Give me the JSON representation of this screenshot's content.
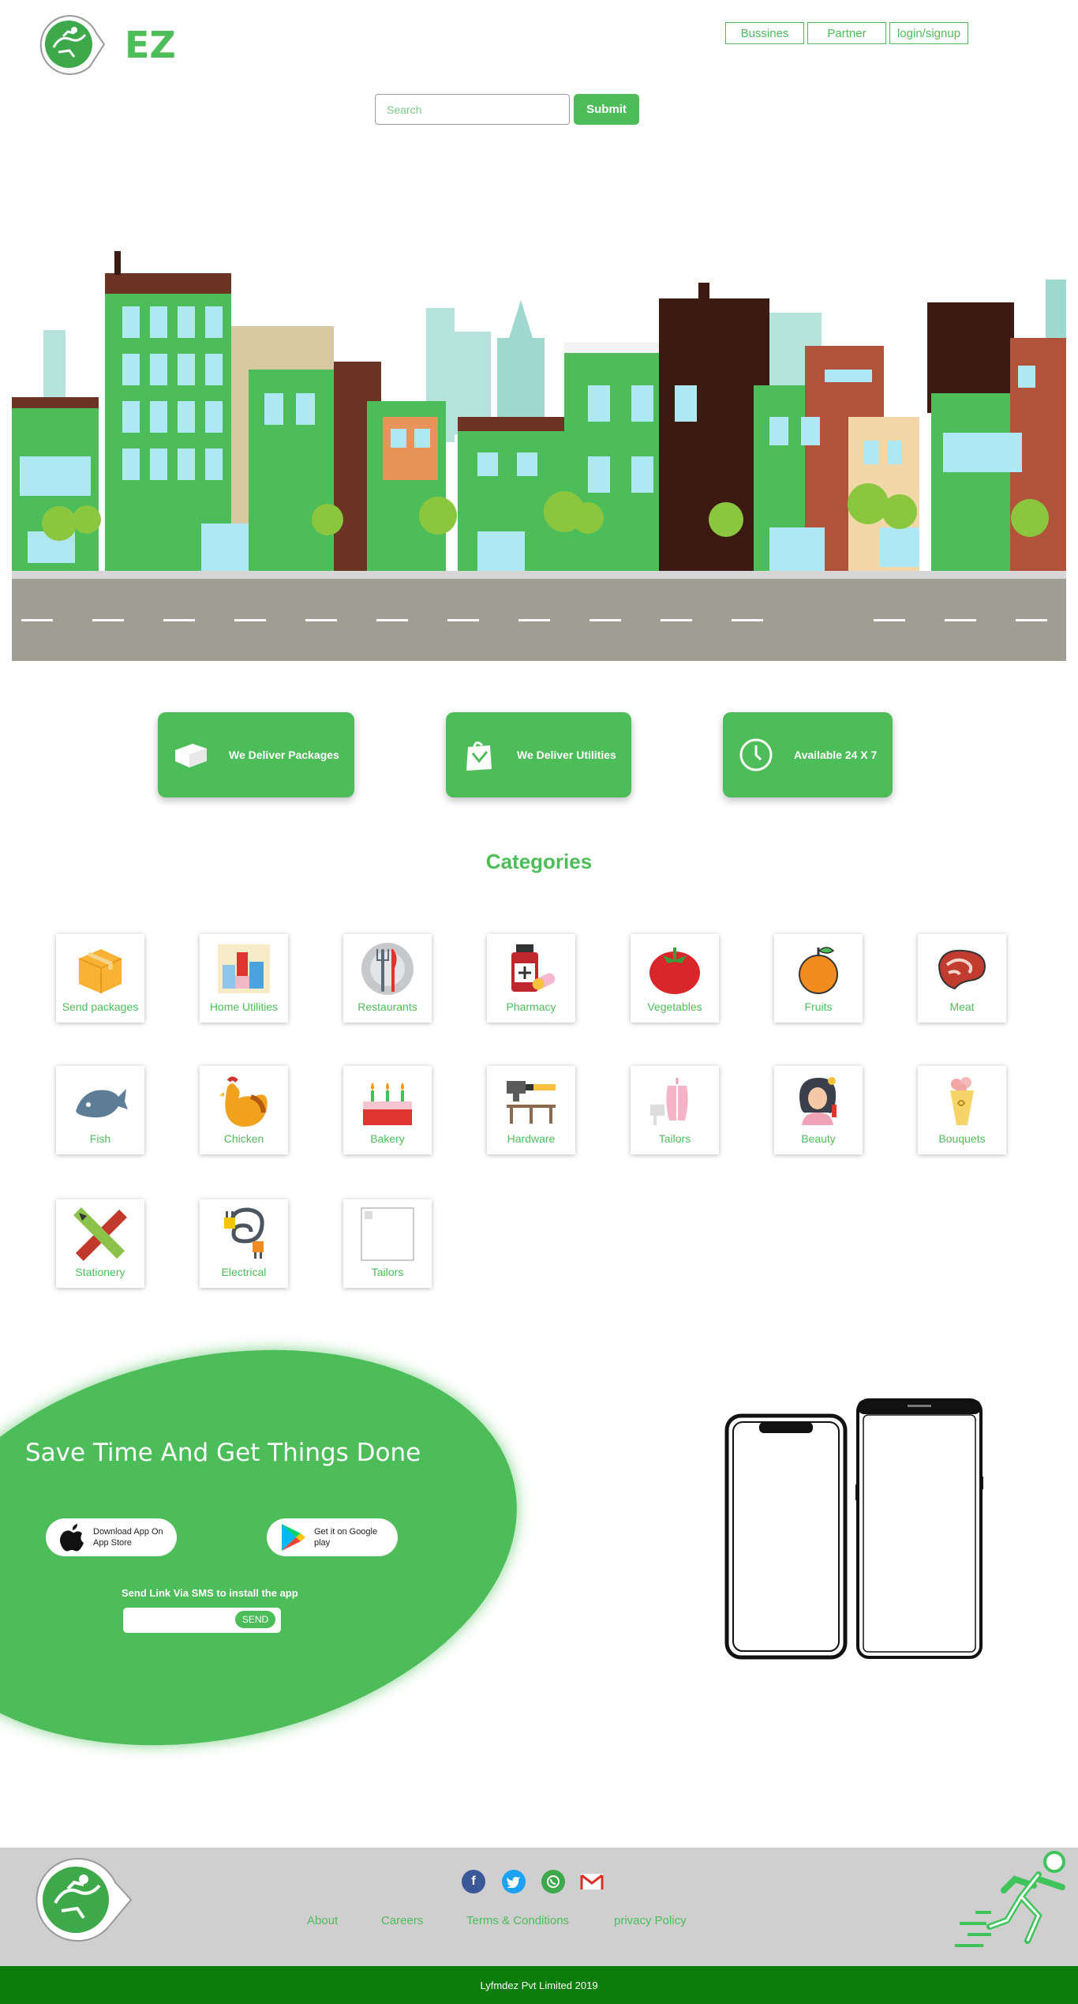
{
  "header": {
    "brand": "EZ",
    "nav": [
      "Bussines",
      "Partner",
      "login/signup"
    ],
    "search_placeholder": "Search",
    "submit_label": "Submit"
  },
  "features": [
    {
      "label": "We Deliver Packages",
      "icon": "package-icon"
    },
    {
      "label": "We Deliver Utilities",
      "icon": "shopping-bag-icon"
    },
    {
      "label": "Available 24 X 7",
      "icon": "clock-icon"
    }
  ],
  "categories_title": "Categories",
  "categories": [
    {
      "label": "Send packages",
      "icon": "box-icon"
    },
    {
      "label": "Home Utilities",
      "icon": "home-utilities-icon"
    },
    {
      "label": "Restaurants",
      "icon": "plate-cutlery-icon"
    },
    {
      "label": "Pharmacy",
      "icon": "medicine-icon"
    },
    {
      "label": "Vegetables",
      "icon": "tomato-icon"
    },
    {
      "label": "Fruits",
      "icon": "orange-icon"
    },
    {
      "label": "Meat",
      "icon": "steak-icon"
    },
    {
      "label": "Fish",
      "icon": "fish-icon"
    },
    {
      "label": "Chicken",
      "icon": "rooster-icon"
    },
    {
      "label": "Bakery",
      "icon": "cake-icon"
    },
    {
      "label": "Hardware",
      "icon": "hammer-icon"
    },
    {
      "label": "Tailors",
      "icon": "tailor-mannequin-icon"
    },
    {
      "label": "Beauty",
      "icon": "beauty-woman-icon"
    },
    {
      "label": "Bouquets",
      "icon": "bouquet-icon"
    },
    {
      "label": "Stationery",
      "icon": "pencil-ruler-icon"
    },
    {
      "label": "Electrical",
      "icon": "plug-cable-icon"
    },
    {
      "label": "Tailors",
      "icon": "broken-image-icon"
    }
  ],
  "promo": {
    "title": "Save Time And Get Things Done",
    "app_store": "Download App On App Store",
    "google_play": "Get it on Google play",
    "sms_title": "Send Link Via SMS to install the app",
    "send_label": "SEND"
  },
  "footer": {
    "links": [
      "About",
      "Careers",
      "Terms & Conditions",
      "privacy Policy"
    ],
    "social": [
      "facebook-icon",
      "twitter-icon",
      "whatsapp-icon",
      "gmail-icon"
    ],
    "copyright": "Lyfmdez Pvt Limited 2019"
  },
  "colors": {
    "accent": "#4dbd5a",
    "footer_bg": "#cfcfcf",
    "copyright_bg": "#0a7d0a",
    "road": "#a09d92"
  }
}
